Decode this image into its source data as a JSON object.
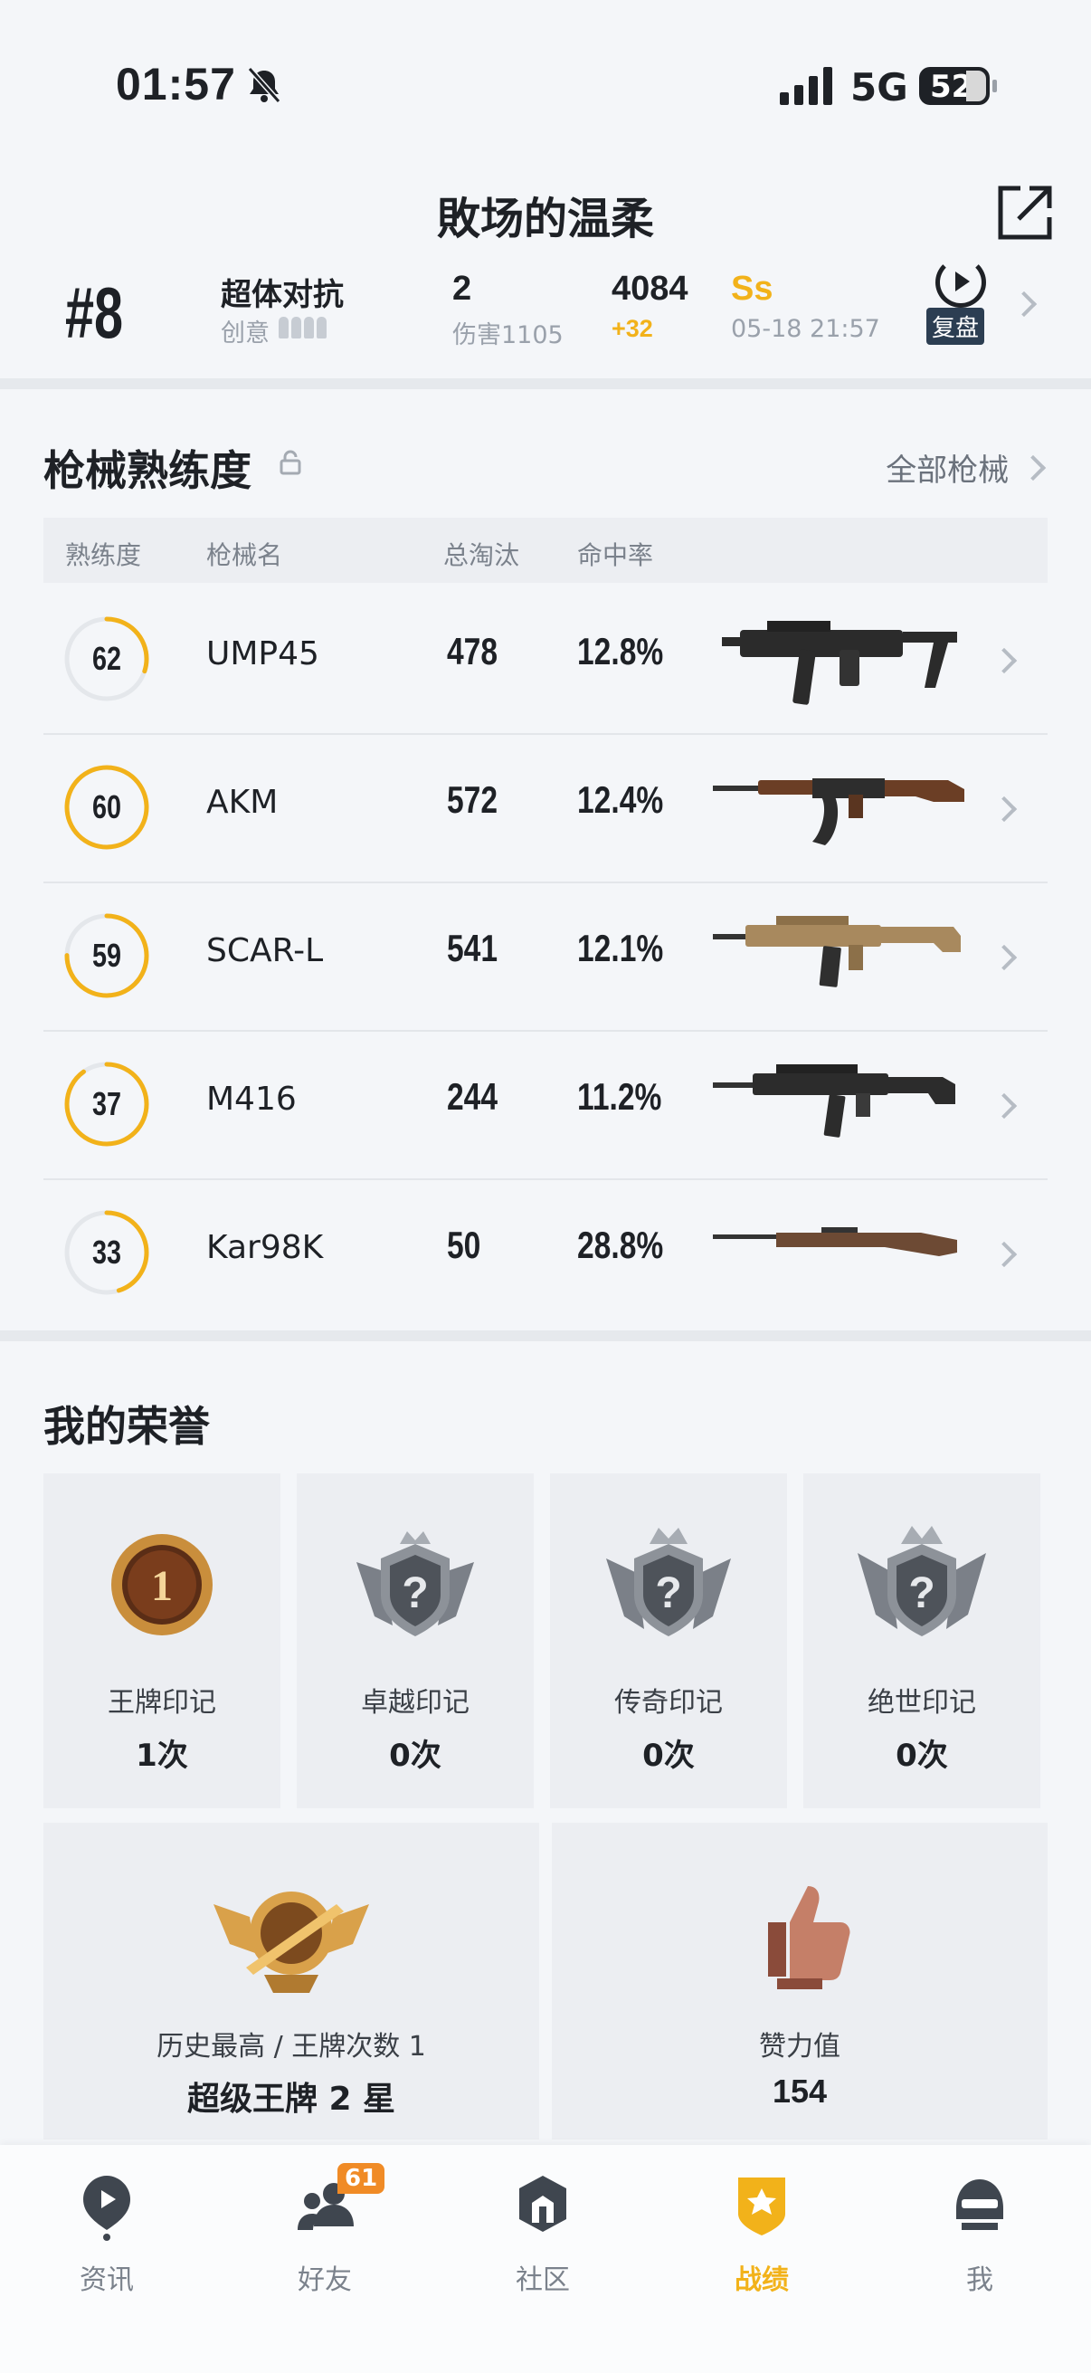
{
  "status_bar": {
    "time": "01:57",
    "network": "5G",
    "battery": "52"
  },
  "header": {
    "title": "敗场的温柔"
  },
  "match": {
    "rank": "#8",
    "mode": "超体对抗",
    "map": "创意",
    "kills": "2",
    "damage": "伤害1105",
    "score": "4084",
    "score_delta": "+32",
    "grade": "Ss",
    "time": "05-18 21:57",
    "replay_label": "复盘"
  },
  "weapons": {
    "title": "枪械熟练度",
    "all_label": "全部枪械",
    "columns": {
      "proficiency": "熟练度",
      "name": "枪械名",
      "kills": "总淘汰",
      "hit_rate": "命中率"
    },
    "rows": [
      {
        "proficiency": "62",
        "progress": 0.3,
        "name": "UMP45",
        "kills": "478",
        "hit_rate": "12.8%",
        "icon": "ump45"
      },
      {
        "proficiency": "60",
        "progress": 1.0,
        "name": "AKM",
        "kills": "572",
        "hit_rate": "12.4%",
        "icon": "akm"
      },
      {
        "proficiency": "59",
        "progress": 0.75,
        "name": "SCAR-L",
        "kills": "541",
        "hit_rate": "12.1%",
        "icon": "scar-l"
      },
      {
        "proficiency": "37",
        "progress": 0.9,
        "name": "M416",
        "kills": "244",
        "hit_rate": "11.2%",
        "icon": "m416"
      },
      {
        "proficiency": "33",
        "progress": 0.45,
        "name": "Kar98K",
        "kills": "50",
        "hit_rate": "28.8%",
        "icon": "kar98k"
      }
    ]
  },
  "honors": {
    "title": "我的荣誉",
    "badges": [
      {
        "label": "王牌印记",
        "count": "1次",
        "icon": "ace-medal-icon"
      },
      {
        "label": "卓越印记",
        "count": "0次",
        "icon": "mystery-crest-icon"
      },
      {
        "label": "传奇印记",
        "count": "0次",
        "icon": "mystery-crest-icon"
      },
      {
        "label": "绝世印记",
        "count": "0次",
        "icon": "mystery-crest-icon"
      }
    ],
    "tier": {
      "label": "历史最高 / 王牌次数 1",
      "value": "超级王牌 2 星"
    },
    "likes": {
      "label": "赞力值",
      "value": "154"
    }
  },
  "tabs": [
    {
      "label": "资讯",
      "icon": "news-icon"
    },
    {
      "label": "好友",
      "icon": "friends-icon",
      "badge": "61"
    },
    {
      "label": "社区",
      "icon": "community-icon"
    },
    {
      "label": "战绩",
      "icon": "record-icon",
      "active": true
    },
    {
      "label": "我",
      "icon": "profile-helmet-icon"
    }
  ],
  "colors": {
    "accent": "#f2b21a",
    "text": "#1e2126",
    "muted": "#9aa1ab",
    "background": "#f4f6f9"
  }
}
